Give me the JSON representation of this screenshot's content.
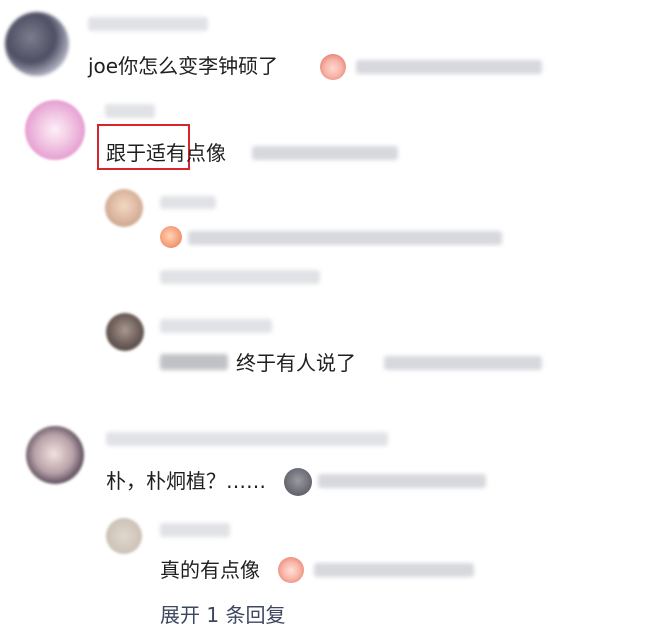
{
  "comments": [
    {
      "text": "joe你怎么变李钟硕了",
      "replies": [
        {
          "text": "跟于适有点像"
        },
        {
          "text": ""
        },
        {
          "text": "终于有人说了"
        }
      ]
    },
    {
      "text": "朴，朴炯植？……",
      "replies": [
        {
          "text": "真的有点像"
        }
      ],
      "expand_replies": "展开 1 条回复"
    }
  ],
  "colors": {
    "highlight": "#d8252c",
    "blur": "#c9cbd2",
    "expand": "#4a5478"
  },
  "icons": [
    "crying-face-emoji",
    "shocked-face-emoji",
    "peach-emoji",
    "sad-ghost-emoji"
  ]
}
